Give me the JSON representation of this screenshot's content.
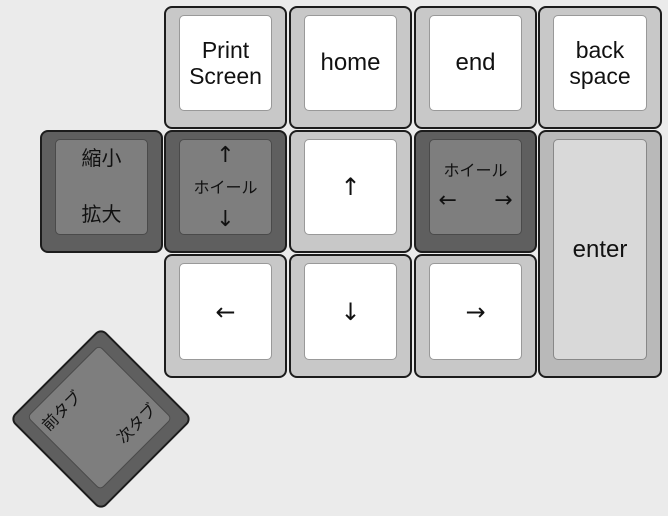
{
  "keys": {
    "print_screen": [
      "Print",
      "Screen"
    ],
    "home": "home",
    "end": "end",
    "backspace": [
      "back",
      "space"
    ],
    "zoom": [
      "縮小",
      "拡大"
    ],
    "wheel_vertical": {
      "up": "↑",
      "label": "ホイール",
      "down": "↓"
    },
    "up": "↑",
    "wheel_horizontal": {
      "label": "ホイール",
      "left": "←",
      "right": "→"
    },
    "enter": "enter",
    "left": "←",
    "down": "↓",
    "right": "→",
    "tab_switch": [
      "前タブ",
      "次タブ"
    ]
  }
}
